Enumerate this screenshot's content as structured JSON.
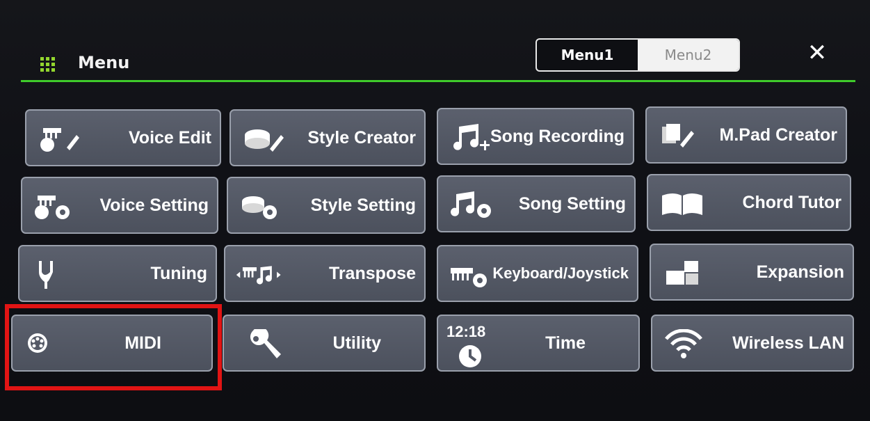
{
  "header": {
    "title": "Menu",
    "tabs": [
      {
        "label": "Menu1",
        "active": true
      },
      {
        "label": "Menu2",
        "active": false
      }
    ],
    "close_icon": "close-icon"
  },
  "tiles": [
    {
      "label": "Voice Edit",
      "icon": "voice-edit-icon"
    },
    {
      "label": "Style Creator",
      "icon": "style-creator-icon"
    },
    {
      "label": "Song Recording",
      "icon": "song-recording-icon"
    },
    {
      "label": "M.Pad Creator",
      "icon": "mpad-creator-icon"
    },
    {
      "label": "Voice Setting",
      "icon": "voice-setting-icon"
    },
    {
      "label": "Style Setting",
      "icon": "style-setting-icon"
    },
    {
      "label": "Song Setting",
      "icon": "song-setting-icon"
    },
    {
      "label": "Chord Tutor",
      "icon": "chord-tutor-icon"
    },
    {
      "label": "Tuning",
      "icon": "tuning-fork-icon"
    },
    {
      "label": "Transpose",
      "icon": "transpose-icon"
    },
    {
      "label": "Keyboard/Joystick",
      "icon": "keyboard-joystick-icon"
    },
    {
      "label": "Expansion",
      "icon": "expansion-icon"
    },
    {
      "label": "MIDI",
      "icon": "midi-icon"
    },
    {
      "label": "Utility",
      "icon": "wrench-icon"
    },
    {
      "label": "Time",
      "icon": "clock-icon",
      "time_text": "12:18"
    },
    {
      "label": "Wireless LAN",
      "icon": "wifi-icon"
    }
  ],
  "colors": {
    "accent_line": "#3fcb2b",
    "highlight_box": "#e11414",
    "tile_bg": "#545966"
  }
}
